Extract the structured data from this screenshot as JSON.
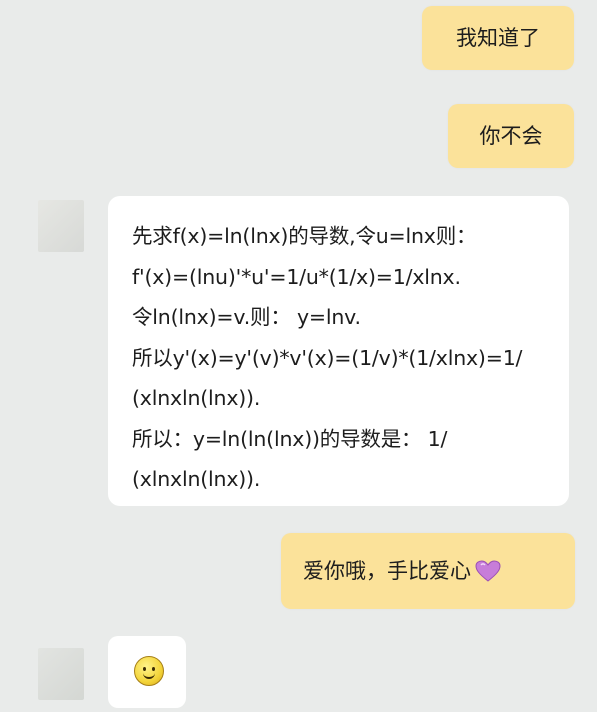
{
  "messages": {
    "sent_1": "我知道了",
    "sent_2": "你不会",
    "solution_lines": [
      "先求f(x)=ln(lnx)的导数,令u=lnx则：",
      "f'(x)=(lnu)'*u'=1/u*(1/x)=1/xlnx.",
      "令ln(lnx)=v.则： y=lnv.",
      "所以y'(x)=y'(v)*v'(x)=(1/v)*(1/xlnx)=1/",
      "(xlnxln(lnx)).",
      "所以：y=ln(ln(lnx))的导数是： 1/",
      "(xlnxln(lnx))."
    ],
    "sent_3": "爱你哦，手比爱心",
    "sent_3_icon": "purple-heart-emoji-icon",
    "received_emoji": "smiley-face-emoji-icon"
  },
  "colors": {
    "background": "#e9ebea",
    "sent_bubble": "#fbe29a",
    "received_bubble": "#ffffff",
    "heart": "#c77dd9"
  }
}
